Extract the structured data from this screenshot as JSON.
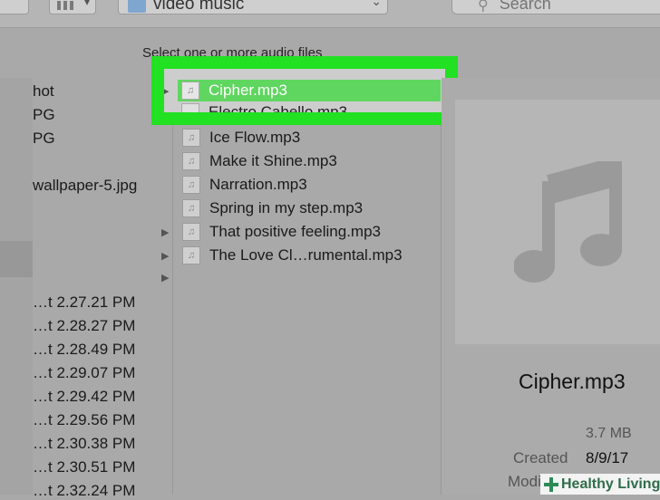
{
  "toolbar": {
    "location": "video music",
    "search_placeholder": "Search"
  },
  "dialog": {
    "prompt": "Select one or more audio files"
  },
  "left_column": {
    "items": [
      "hot",
      "PG",
      "PG",
      "wallpaper-5.jpg"
    ],
    "timestamps": [
      "…t 2.27.21 PM",
      "…t 2.28.27 PM",
      "…t 2.28.49 PM",
      "…t 2.29.07 PM",
      "…t 2.29.42 PM",
      "…t 2.29.56 PM",
      "…t 2.30.38 PM",
      "…t 2.30.51 PM",
      "…t 2.32.24 PM"
    ]
  },
  "file_list": {
    "selected": "Cipher.mp3",
    "partially_hidden": "Electro Cabello.mp3",
    "files": [
      "Ice Flow.mp3",
      "Make it Shine.mp3",
      "Narration.mp3",
      "Spring in my step.mp3",
      "That positive feeling.mp3",
      "The Love Cl…rumental.mp3"
    ]
  },
  "preview": {
    "title": "Cipher.mp3",
    "size": "3.7 MB",
    "created_label": "Created",
    "created_value": "8/9/17",
    "modified_label": "Modi"
  },
  "watermark": {
    "text": "Healthy Living"
  },
  "colors": {
    "highlight": "#22e022",
    "selection": "#5fd65f"
  }
}
